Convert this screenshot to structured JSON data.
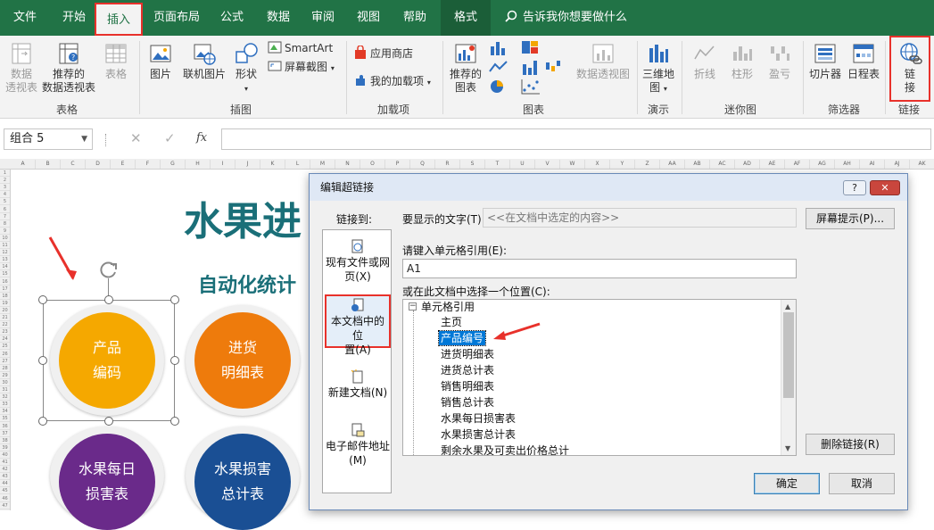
{
  "menu": {
    "tabs": [
      "文件",
      "开始",
      "插入",
      "页面布局",
      "公式",
      "数据",
      "审阅",
      "视图",
      "帮助",
      "格式"
    ],
    "search": "告诉我你想要做什么"
  },
  "ribbon": {
    "pivot_recommended": "数据\n透视表",
    "pivot_recommended_lines": [
      "数据",
      "透视表"
    ],
    "recommended_pivot_lines": [
      "推荐的",
      "数据透视表"
    ],
    "table": "表格",
    "group_tables": "表格",
    "picture": "图片",
    "online_picture": "联机图片",
    "shapes": "形状",
    "smartart": "SmartArt",
    "screenshot": "屏幕截图",
    "group_illustrations": "插图",
    "store": "应用商店",
    "my_addins": "我的加载项",
    "group_addins": "加载项",
    "recommended_charts_lines": [
      "推荐的",
      "图表"
    ],
    "pivot_chart": "数据透视图",
    "group_charts": "图表",
    "map3d_lines": [
      "三维地",
      "图"
    ],
    "group_tours": "演示",
    "spark_line": "折线",
    "spark_column": "柱形",
    "spark_winloss": "盈亏",
    "group_sparklines": "迷你图",
    "slicer": "切片器",
    "timeline": "日程表",
    "group_filters": "筛选器",
    "link_lines": [
      "链",
      "接"
    ],
    "group_links": "链接"
  },
  "formula_bar": {
    "name_box": "组合 5",
    "cancel": "✕",
    "enter": "✓",
    "fx": "fx"
  },
  "sheet": {
    "col_letters": [
      "A",
      "B",
      "C",
      "D",
      "E",
      "F",
      "G",
      "H",
      "I",
      "J",
      "K",
      "L",
      "M",
      "N",
      "O",
      "P",
      "Q",
      "R",
      "S",
      "T",
      "U",
      "V",
      "W",
      "X",
      "Y",
      "Z",
      "AA",
      "AB",
      "AC",
      "AD",
      "AE",
      "AF",
      "AG",
      "AH",
      "AI",
      "AJ",
      "AK"
    ],
    "title": "水果进",
    "subtitle": "自动化统计",
    "circles": [
      {
        "lines": [
          "产品",
          "编码"
        ],
        "color": "#f5a800"
      },
      {
        "lines": [
          "进货",
          "明细表"
        ],
        "color": "#ee7b0c"
      },
      {
        "lines": [
          "水果每日",
          "损害表"
        ],
        "color": "#6a2a8a"
      },
      {
        "lines": [
          "水果损害",
          "总计表"
        ],
        "color": "#1a4f94"
      }
    ]
  },
  "dialog": {
    "title": "编辑超链接",
    "help": "?",
    "close": "✕",
    "link_to_label": "链接到:",
    "link_options": [
      {
        "lines": [
          "现有文件或网",
          "页(X)"
        ]
      },
      {
        "lines": [
          "本文档中的位",
          "置(A)"
        ]
      },
      {
        "lines": [
          "新建文档(N)"
        ]
      },
      {
        "lines": [
          "电子邮件地址",
          "(M)"
        ]
      }
    ],
    "display_text_label": "要显示的文字(T):",
    "display_text_value": "<<在文档中选定的内容>>",
    "screentip_button": "屏幕提示(P)...",
    "cell_ref_label": "请键入单元格引用(E):",
    "cell_ref_value": "A1",
    "place_label": "或在此文档中选择一个位置(C):",
    "tree_root": "单元格引用",
    "tree_items": [
      "主页",
      "产品编号",
      "进货明细表",
      "进货总计表",
      "销售明细表",
      "销售总计表",
      "水果每日损害表",
      "水果损害总计表",
      "剩余水果及可卖出价格总计"
    ],
    "remove_link_button": "删除链接(R)",
    "ok_button": "确定",
    "cancel_button": "取消"
  }
}
